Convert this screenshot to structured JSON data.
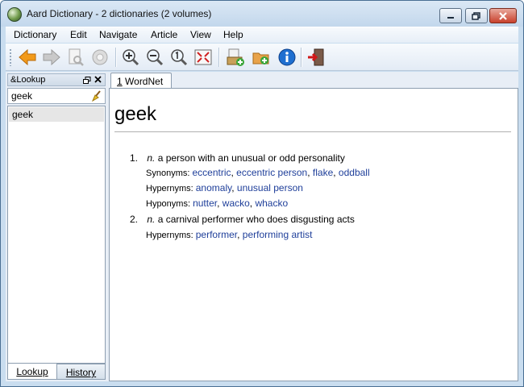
{
  "window": {
    "title": "Aard Dictionary - 2 dictionaries (2 volumes)"
  },
  "menu": [
    "Dictionary",
    "Edit",
    "Navigate",
    "Article",
    "View",
    "Help"
  ],
  "toolbar": {
    "icons": [
      "back-icon",
      "forward-icon",
      "find-page-icon",
      "random-icon",
      "zoom-in-icon",
      "zoom-out-icon",
      "zoom-reset-icon",
      "fullscreen-icon",
      "add-dictionary-icon",
      "add-folder-icon",
      "info-icon",
      "exit-icon"
    ]
  },
  "lookup": {
    "title": "&Lookup",
    "query": "geek",
    "results": [
      "geek"
    ],
    "tabs": {
      "lookup": "Lookup",
      "history": "History"
    }
  },
  "article_tab": {
    "number": "1",
    "label": "WordNet"
  },
  "article": {
    "headword": "geek",
    "senses": [
      {
        "num": "1.",
        "pos": "n.",
        "definition": "a person with an unusual or odd personality",
        "relations": [
          {
            "label": "Synonyms:",
            "terms": [
              "eccentric",
              "eccentric person",
              "flake",
              "oddball"
            ]
          },
          {
            "label": "Hypernyms:",
            "terms": [
              "anomaly",
              "unusual person"
            ]
          },
          {
            "label": "Hyponyms:",
            "terms": [
              "nutter",
              "wacko",
              "whacko"
            ]
          }
        ]
      },
      {
        "num": "2.",
        "pos": "n.",
        "definition": "a carnival performer who does disgusting acts",
        "relations": [
          {
            "label": "Hypernyms:",
            "terms": [
              "performer",
              "performing artist"
            ]
          }
        ]
      }
    ]
  },
  "colors": {
    "link": "#1f3f9a",
    "chrome": "#c9ddef"
  }
}
